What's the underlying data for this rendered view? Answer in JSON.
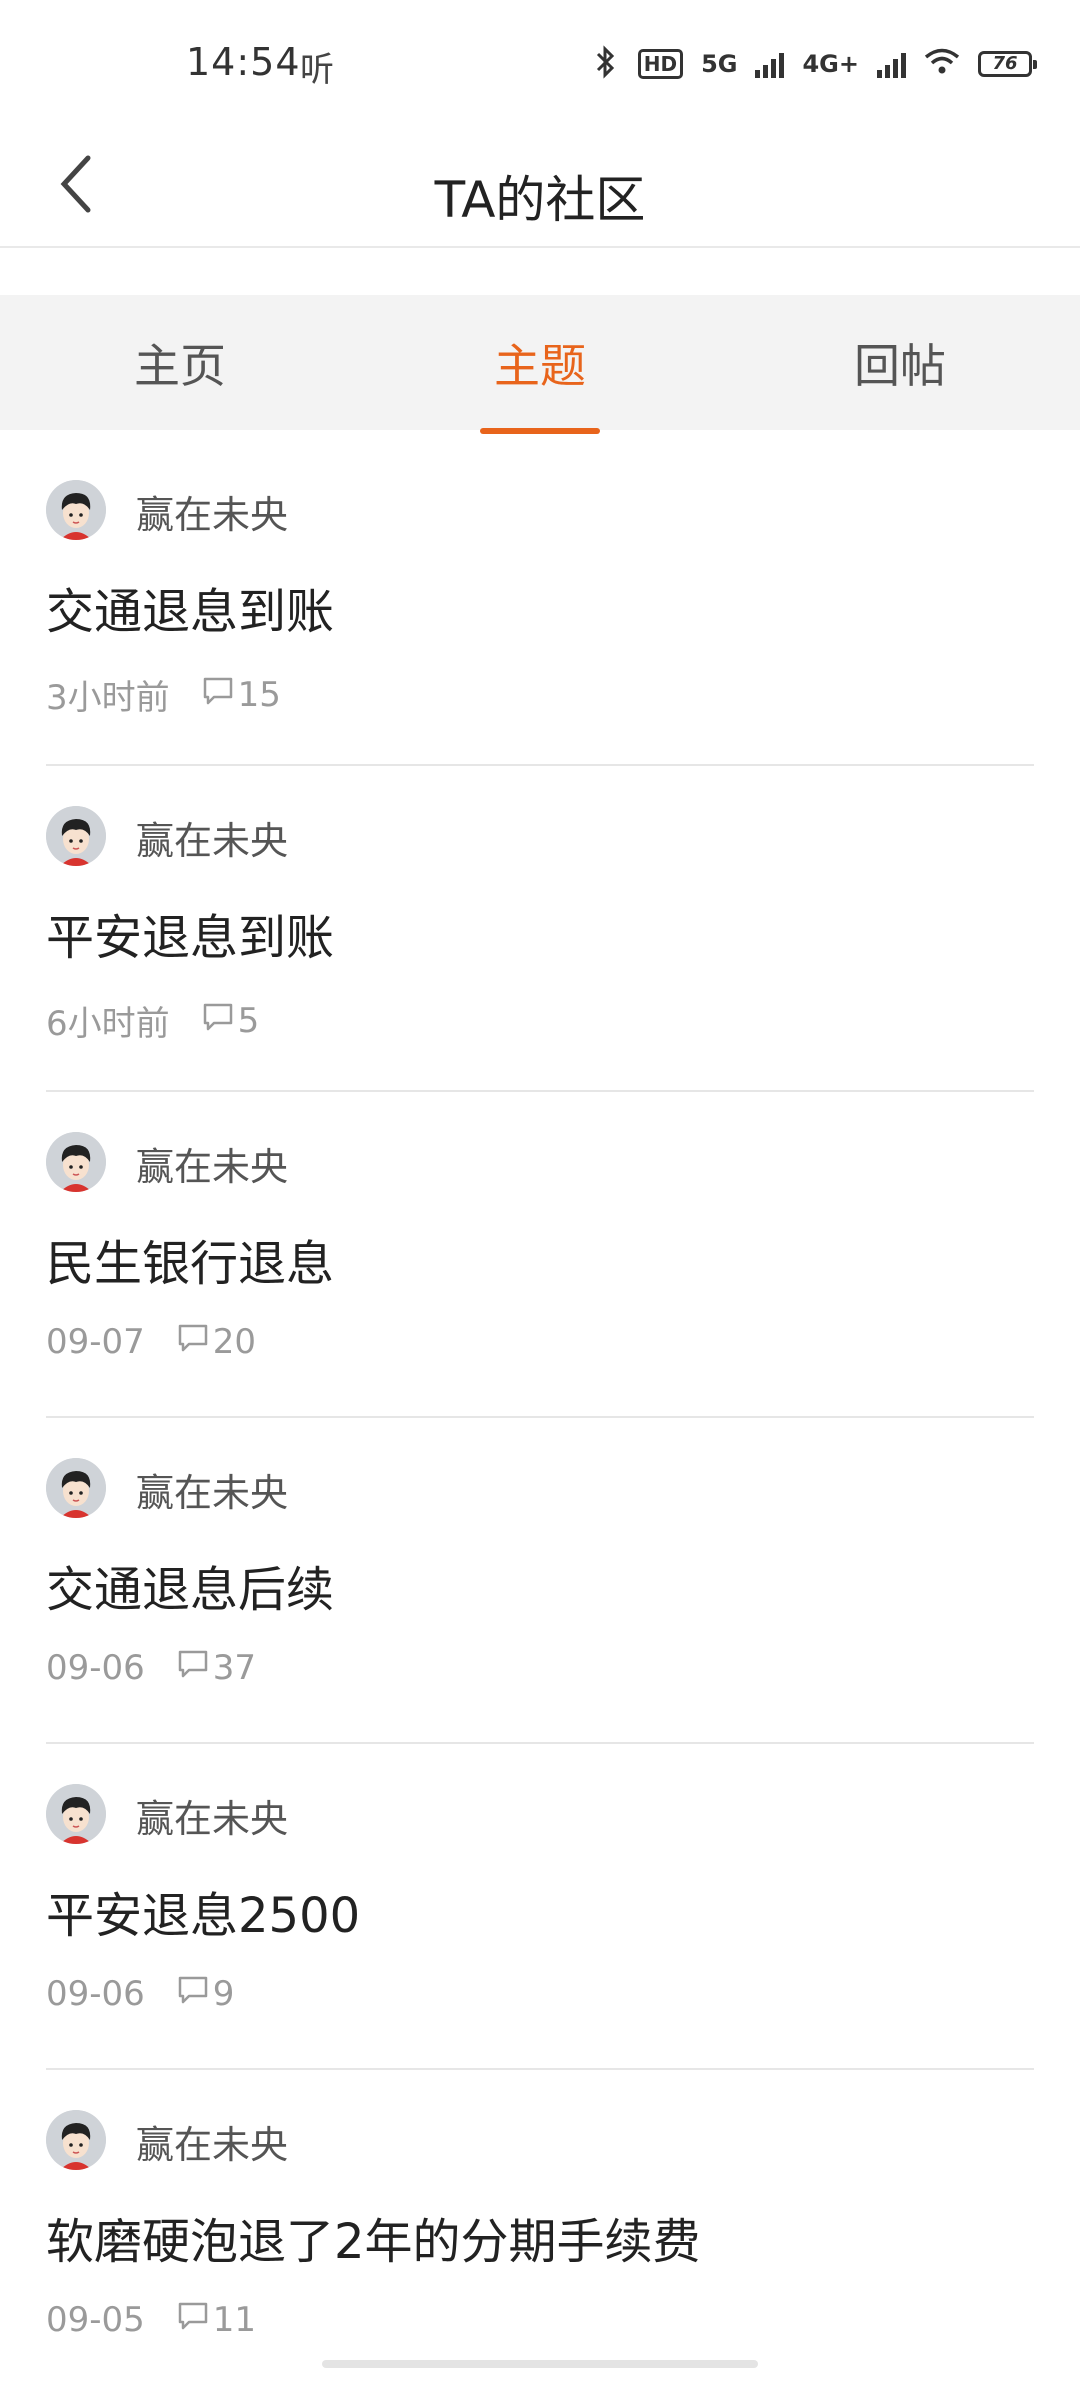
{
  "status": {
    "time": "14:54",
    "listen_glyph": "听",
    "network_5g": "5G",
    "network_4g": "4G+",
    "hd": "HD",
    "battery": "76"
  },
  "header": {
    "title": "TA的社区",
    "back_icon": "chevron-left-icon"
  },
  "tabs": [
    {
      "label": "主页",
      "active": false
    },
    {
      "label": "主题",
      "active": true
    },
    {
      "label": "回帖",
      "active": false
    }
  ],
  "accent_color": "#e8641b",
  "posts": [
    {
      "author": "赢在未央",
      "title": "交通退息到账",
      "time": "3小时前",
      "comments": "15"
    },
    {
      "author": "赢在未央",
      "title": "平安退息到账",
      "time": "6小时前",
      "comments": "5"
    },
    {
      "author": "赢在未央",
      "title": "民生银行退息",
      "time": "09-07",
      "comments": "20"
    },
    {
      "author": "赢在未央",
      "title": "交通退息后续",
      "time": "09-06",
      "comments": "37"
    },
    {
      "author": "赢在未央",
      "title": "平安退息2500",
      "time": "09-06",
      "comments": "9"
    },
    {
      "author": "赢在未央",
      "title": "软磨硬泡退了2年的分期手续费",
      "time": "09-05",
      "comments": "11"
    }
  ]
}
